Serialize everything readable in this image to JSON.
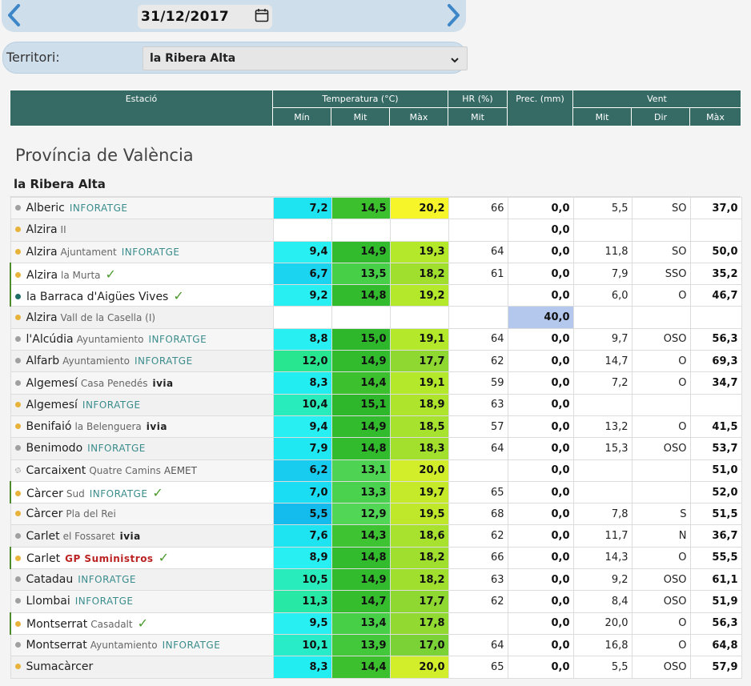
{
  "date": "31/12/2017",
  "territory": {
    "label": "Territori:",
    "selected": "la Ribera Alta"
  },
  "header": {
    "station": "Estació",
    "temperature": "Temperatura (°C)",
    "hr": "HR (%)",
    "prec": "Prec. (mm)",
    "wind": "Vent",
    "min": "Mín",
    "mit": "Mit",
    "max": "Màx",
    "hr_mit": "Mit",
    "wind_mit": "Mit",
    "wind_dir": "Dir",
    "wind_max": "Màx"
  },
  "province": "Província de València",
  "comarca": "la Ribera Alta",
  "colors": {
    "header": "#356a65",
    "accent": "#3d87c8",
    "check": "#4c9a2c"
  },
  "rows": [
    {
      "name": "Alberic",
      "loc": "",
      "brand": "INFORATGE",
      "brand_type": "inforatge",
      "dot": "#a0a0a0",
      "check": false,
      "tmin": "7,2",
      "tmid": "14,5",
      "tmax": "20,2",
      "hr": "66",
      "prec": "0,0",
      "wmit": "5,5",
      "wdir": "SO",
      "wmax": "37,0",
      "cmin": "#1ee4f2",
      "cmid": "#3cc02e",
      "cmax": "#f5f52a",
      "cprec": ""
    },
    {
      "name": "Alzira",
      "loc": "II",
      "brand": "",
      "brand_type": "",
      "dot": "#e8b33a",
      "check": false,
      "tmin": "",
      "tmid": "",
      "tmax": "",
      "hr": "",
      "prec": "0,0",
      "wmit": "",
      "wdir": "",
      "wmax": "",
      "cmin": "",
      "cmid": "",
      "cmax": "",
      "cprec": ""
    },
    {
      "name": "Alzira",
      "loc": "Ajuntament",
      "brand": "INFORATGE",
      "brand_type": "inforatge",
      "dot": "#e8b33a",
      "check": false,
      "tmin": "9,4",
      "tmid": "14,9",
      "tmax": "19,3",
      "hr": "64",
      "prec": "0,0",
      "wmit": "11,8",
      "wdir": "SO",
      "wmax": "50,0",
      "cmin": "#28f0f2",
      "cmid": "#33bb2e",
      "cmax": "#b4e82a",
      "cprec": ""
    },
    {
      "name": "Alzira",
      "loc": "la Murta",
      "brand": "",
      "brand_type": "",
      "dot": "#e8b33a",
      "check": true,
      "tmin": "6,7",
      "tmid": "13,5",
      "tmax": "18,2",
      "hr": "61",
      "prec": "0,0",
      "wmit": "7,9",
      "wdir": "SSO",
      "wmax": "35,2",
      "cmin": "#1ad4f0",
      "cmid": "#48cf48",
      "cmax": "#a0df2e",
      "cprec": ""
    },
    {
      "name": "la Barraca d'Aigües Vives",
      "loc": "",
      "brand": "",
      "brand_type": "",
      "dot": "#1d6e66",
      "check": true,
      "tmin": "9,2",
      "tmid": "14,8",
      "tmax": "19,2",
      "hr": "",
      "prec": "0,0",
      "wmit": "6,0",
      "wdir": "O",
      "wmax": "46,7",
      "cmin": "#28f0f2",
      "cmid": "#33bb2e",
      "cmax": "#b4e82a",
      "cprec": ""
    },
    {
      "name": "Alzira",
      "loc": "Vall de la Casella (I)",
      "brand": "",
      "brand_type": "",
      "dot": "#e8b33a",
      "check": false,
      "tmin": "",
      "tmid": "",
      "tmax": "",
      "hr": "",
      "prec": "40,0",
      "wmit": "",
      "wdir": "",
      "wmax": "",
      "cmin": "",
      "cmid": "",
      "cmax": "",
      "cprec": "#b4c8ee"
    },
    {
      "name": "l'Alcúdia",
      "loc": "Ayuntamiento",
      "brand": "INFORATGE",
      "brand_type": "inforatge",
      "dot": "#a0a0a0",
      "check": false,
      "tmin": "8,8",
      "tmid": "15,0",
      "tmax": "19,1",
      "hr": "64",
      "prec": "0,0",
      "wmit": "9,7",
      "wdir": "OSO",
      "wmax": "56,3",
      "cmin": "#28f0f2",
      "cmid": "#2eb72a",
      "cmax": "#b4e82a",
      "cprec": ""
    },
    {
      "name": "Alfarb",
      "loc": "Ayuntamiento",
      "brand": "INFORATGE",
      "brand_type": "inforatge",
      "dot": "#a0a0a0",
      "check": false,
      "tmin": "12,0",
      "tmid": "14,9",
      "tmax": "17,7",
      "hr": "62",
      "prec": "0,0",
      "wmit": "14,7",
      "wdir": "O",
      "wmax": "69,3",
      "cmin": "#28e690",
      "cmid": "#33bb2e",
      "cmax": "#8fd832",
      "cprec": ""
    },
    {
      "name": "Algemesí",
      "loc": "Casa Penedés",
      "brand": "ivia",
      "brand_type": "ivia",
      "dot": "#a0a0a0",
      "check": false,
      "tmin": "8,3",
      "tmid": "14,4",
      "tmax": "19,1",
      "hr": "59",
      "prec": "0,0",
      "wmit": "7,2",
      "wdir": "O",
      "wmax": "34,7",
      "cmin": "#22eef2",
      "cmid": "#3cc02e",
      "cmax": "#b4e82a",
      "cprec": ""
    },
    {
      "name": "Algemesí",
      "loc": "",
      "brand": "INFORATGE",
      "brand_type": "inforatge",
      "dot": "#e8b33a",
      "check": false,
      "tmin": "10,4",
      "tmid": "15,1",
      "tmax": "18,9",
      "hr": "63",
      "prec": "0,0",
      "wmit": "",
      "wdir": "",
      "wmax": "",
      "cmin": "#28ecbc",
      "cmid": "#2eb72a",
      "cmax": "#aee52c",
      "cprec": ""
    },
    {
      "name": "Benifaió",
      "loc": "la Belenguera",
      "brand": "ivia",
      "brand_type": "ivia",
      "dot": "#e8b33a",
      "check": false,
      "tmin": "9,4",
      "tmid": "14,9",
      "tmax": "18,5",
      "hr": "57",
      "prec": "0,0",
      "wmit": "13,2",
      "wdir": "O",
      "wmax": "41,5",
      "cmin": "#28f0f2",
      "cmid": "#33bb2e",
      "cmax": "#a6e22e",
      "cprec": ""
    },
    {
      "name": "Benimodo",
      "loc": "",
      "brand": "INFORATGE",
      "brand_type": "inforatge",
      "dot": "#a0a0a0",
      "check": false,
      "tmin": "7,9",
      "tmid": "14,8",
      "tmax": "18,3",
      "hr": "64",
      "prec": "0,0",
      "wmit": "15,3",
      "wdir": "OSO",
      "wmax": "53,7",
      "cmin": "#20e8f2",
      "cmid": "#33bb2e",
      "cmax": "#a3e02e",
      "cprec": ""
    },
    {
      "name": "Carcaixent",
      "loc": "Quatre Camins",
      "brand": "AEMET",
      "brand_type": "aemet",
      "dot": "#e0e0e0",
      "check": false,
      "tmin": "6,2",
      "tmid": "13,1",
      "tmax": "20,0",
      "hr": "",
      "prec": "0,0",
      "wmit": "",
      "wdir": "",
      "wmax": "51,0",
      "cmin": "#18ccf0",
      "cmid": "#4ed452",
      "cmax": "#d2ee2a",
      "cprec": ""
    },
    {
      "name": "Càrcer",
      "loc": "Sud",
      "brand": "INFORATGE",
      "brand_type": "inforatge",
      "dot": "#e8b33a",
      "check": true,
      "tmin": "7,0",
      "tmid": "13,3",
      "tmax": "19,7",
      "hr": "65",
      "prec": "0,0",
      "wmit": "",
      "wdir": "",
      "wmax": "52,0",
      "cmin": "#1adcf2",
      "cmid": "#4ad24e",
      "cmax": "#c4ea2a",
      "cprec": ""
    },
    {
      "name": "Càrcer",
      "loc": "Pla del Rei",
      "brand": "",
      "brand_type": "",
      "dot": "#e8b33a",
      "check": false,
      "tmin": "5,5",
      "tmid": "12,9",
      "tmax": "19,5",
      "hr": "68",
      "prec": "0,0",
      "wmit": "7,8",
      "wdir": "S",
      "wmax": "51,5",
      "cmin": "#14bcee",
      "cmid": "#52d656",
      "cmax": "#bfe82a",
      "cprec": ""
    },
    {
      "name": "Carlet",
      "loc": "el Fossaret",
      "brand": "ivia",
      "brand_type": "ivia",
      "dot": "#a0a0a0",
      "check": false,
      "tmin": "7,6",
      "tmid": "14,3",
      "tmax": "18,6",
      "hr": "62",
      "prec": "0,0",
      "wmit": "11,7",
      "wdir": "N",
      "wmax": "36,7",
      "cmin": "#1ee4f2",
      "cmid": "#3ec432",
      "cmax": "#a8e22e",
      "cprec": ""
    },
    {
      "name": "Carlet",
      "loc": "",
      "brand": "GP Suministros",
      "brand_type": "gp",
      "dot": "#e8b33a",
      "check": true,
      "tmin": "8,9",
      "tmid": "14,8",
      "tmax": "18,2",
      "hr": "66",
      "prec": "0,0",
      "wmit": "14,3",
      "wdir": "O",
      "wmax": "55,5",
      "cmin": "#28f0f2",
      "cmid": "#33bb2e",
      "cmax": "#a0df2e",
      "cprec": ""
    },
    {
      "name": "Catadau",
      "loc": "",
      "brand": "INFORATGE",
      "brand_type": "inforatge",
      "dot": "#a0a0a0",
      "check": false,
      "tmin": "10,5",
      "tmid": "14,9",
      "tmax": "18,2",
      "hr": "63",
      "prec": "0,0",
      "wmit": "9,2",
      "wdir": "OSO",
      "wmax": "61,1",
      "cmin": "#28ecbc",
      "cmid": "#33bb2e",
      "cmax": "#a0df2e",
      "cprec": ""
    },
    {
      "name": "Llombai",
      "loc": "",
      "brand": "INFORATGE",
      "brand_type": "inforatge",
      "dot": "#a0a0a0",
      "check": false,
      "tmin": "11,3",
      "tmid": "14,7",
      "tmax": "17,7",
      "hr": "62",
      "prec": "0,0",
      "wmit": "8,4",
      "wdir": "OSO",
      "wmax": "51,9",
      "cmin": "#28e8a6",
      "cmid": "#36bd2e",
      "cmax": "#8fd832",
      "cprec": ""
    },
    {
      "name": "Montserrat",
      "loc": "Casadalt",
      "brand": "",
      "brand_type": "",
      "dot": "#e8b33a",
      "check": true,
      "tmin": "9,5",
      "tmid": "13,4",
      "tmax": "17,8",
      "hr": "",
      "prec": "0,0",
      "wmit": "20,0",
      "wdir": "O",
      "wmax": "56,3",
      "cmin": "#28f0f2",
      "cmid": "#48cf48",
      "cmax": "#92d932",
      "cprec": ""
    },
    {
      "name": "Montserrat",
      "loc": "Ayuntamiento",
      "brand": "INFORATGE",
      "brand_type": "inforatge",
      "dot": "#a0a0a0",
      "check": false,
      "tmin": "10,1",
      "tmid": "13,9",
      "tmax": "17,0",
      "hr": "64",
      "prec": "0,0",
      "wmit": "16,8",
      "wdir": "O",
      "wmax": "64,8",
      "cmin": "#28ecc8",
      "cmid": "#42c83a",
      "cmax": "#7ad236",
      "cprec": ""
    },
    {
      "name": "Sumacàrcer",
      "loc": "",
      "brand": "",
      "brand_type": "",
      "dot": "#e8b33a",
      "check": false,
      "tmin": "8,3",
      "tmid": "14,4",
      "tmax": "20,0",
      "hr": "65",
      "prec": "0,0",
      "wmit": "5,5",
      "wdir": "OSO",
      "wmax": "57,9",
      "cmin": "#22eef2",
      "cmid": "#3cc02e",
      "cmax": "#d2ee2a",
      "cprec": ""
    }
  ]
}
